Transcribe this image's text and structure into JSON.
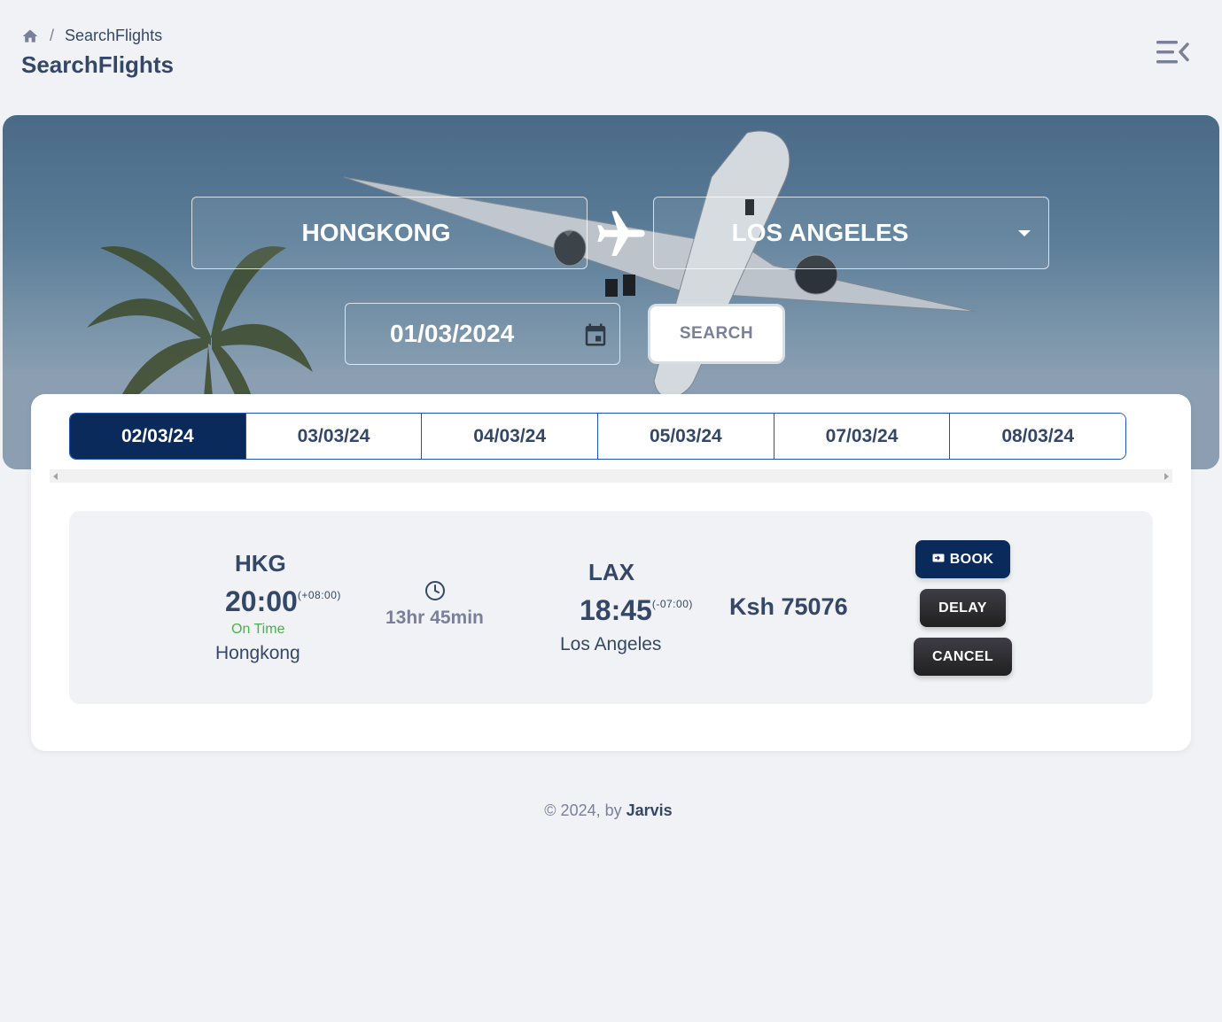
{
  "header": {
    "breadcrumb_current": "SearchFlights",
    "breadcrumb_separator": "/",
    "page_title": "SearchFlights",
    "icons": [
      "home-icon",
      "menu-toggle-icon"
    ]
  },
  "search": {
    "from": "HONGKONG",
    "to": "LOS ANGELES",
    "date": "01/03/2024",
    "search_label": "SEARCH",
    "icons": [
      "airplane-icon",
      "calendar-icon"
    ]
  },
  "date_tabs": [
    {
      "label": "02/03/24",
      "active": true
    },
    {
      "label": "03/03/24",
      "active": false
    },
    {
      "label": "04/03/24",
      "active": false
    },
    {
      "label": "05/03/24",
      "active": false
    },
    {
      "label": "07/03/24",
      "active": false
    },
    {
      "label": "08/03/24",
      "active": false
    }
  ],
  "flight": {
    "origin_code": "HKG",
    "departure_time": "20:00",
    "departure_tz": "(+08:00)",
    "status": "On Time",
    "origin_city": "Hongkong",
    "duration": "13hr 45min",
    "destination_code": "LAX",
    "arrival_time": "18:45",
    "arrival_tz": "(-07:00)",
    "destination_city": "Los Angeles",
    "price": "Ksh 75076",
    "book_label": "BOOK",
    "delay_label": "DELAY",
    "cancel_label": "CANCEL"
  },
  "footer": {
    "prefix": "© 2024, by ",
    "author": "Jarvis"
  },
  "colors": {
    "primary_navy": "#0b2a5c",
    "text_dark": "#344767",
    "text_muted": "#7b809a",
    "status_green": "#4caf50",
    "background": "#f0f2f5"
  }
}
